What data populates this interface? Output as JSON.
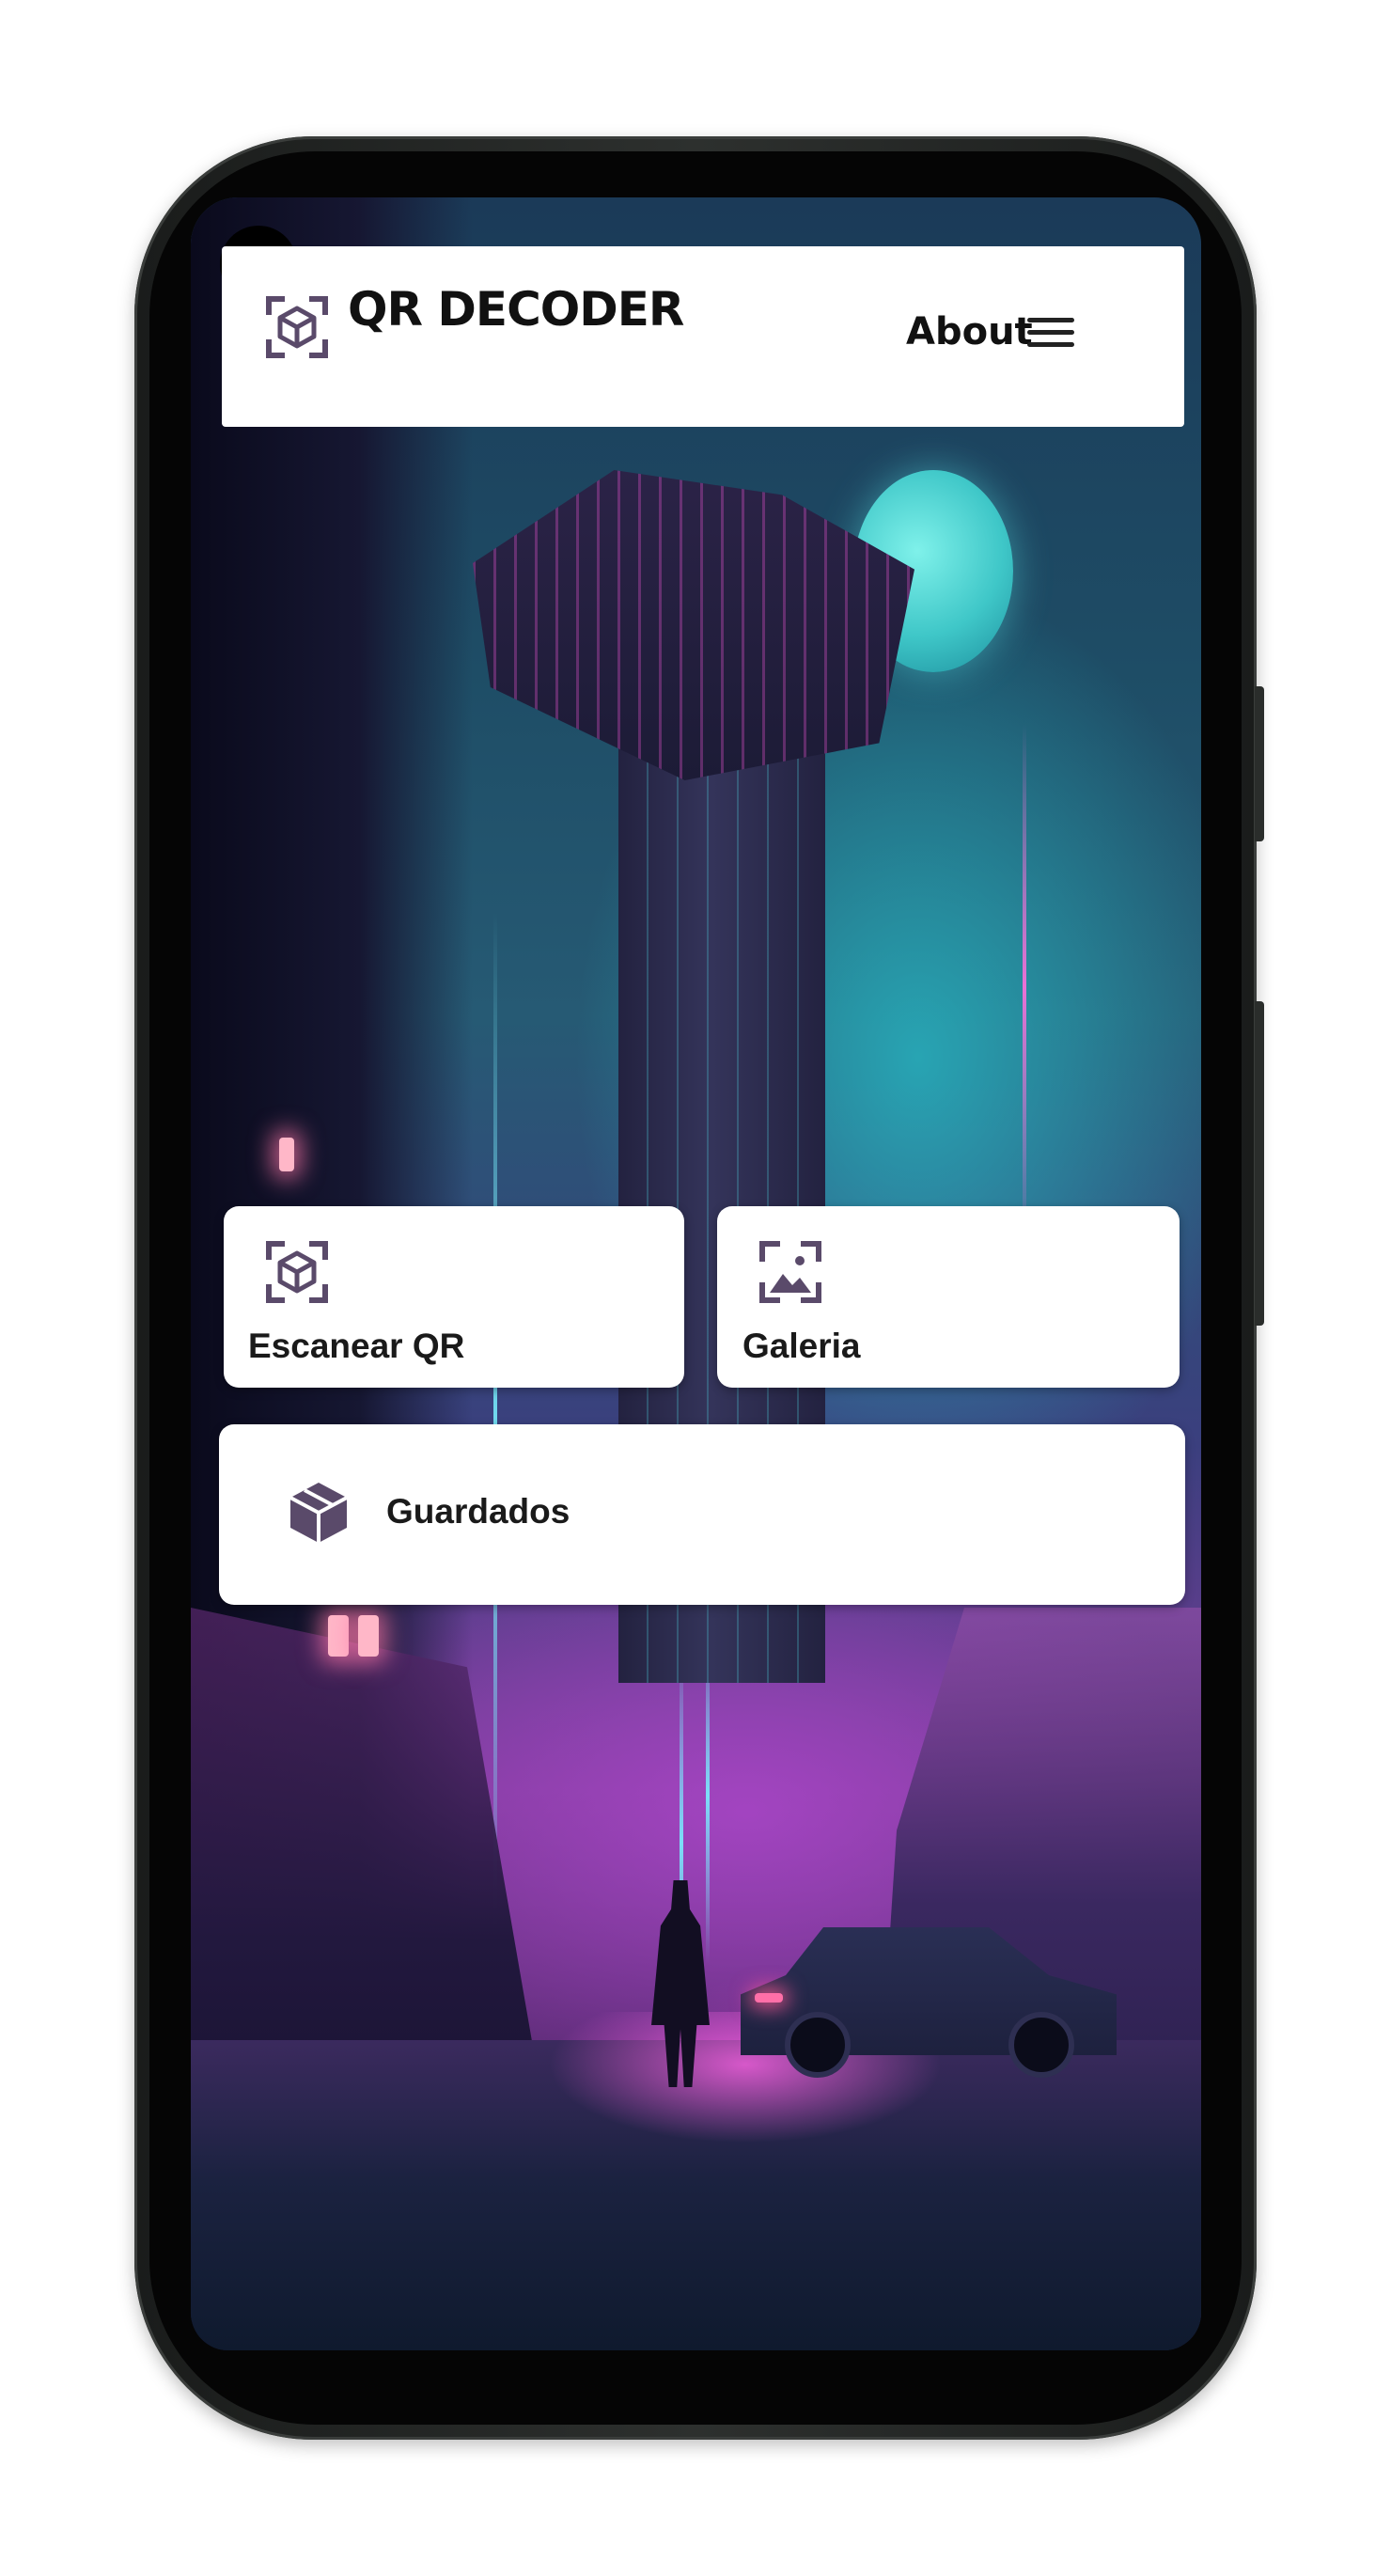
{
  "header": {
    "app_title": "QR DECODER",
    "about_label": "About",
    "logo_icon": "qr-cube-scan-icon",
    "menu_icon": "hamburger-menu-icon"
  },
  "actions": {
    "scan": {
      "label": "Escanear QR",
      "icon": "qr-cube-scan-icon"
    },
    "gallery": {
      "label": "Galeria",
      "icon": "gallery-image-icon"
    },
    "saved": {
      "label": "Guardados",
      "icon": "box-cube-icon"
    }
  },
  "colors": {
    "icon_color": "#5a4a6a",
    "card_background": "#ffffff",
    "text_color": "#111111"
  }
}
